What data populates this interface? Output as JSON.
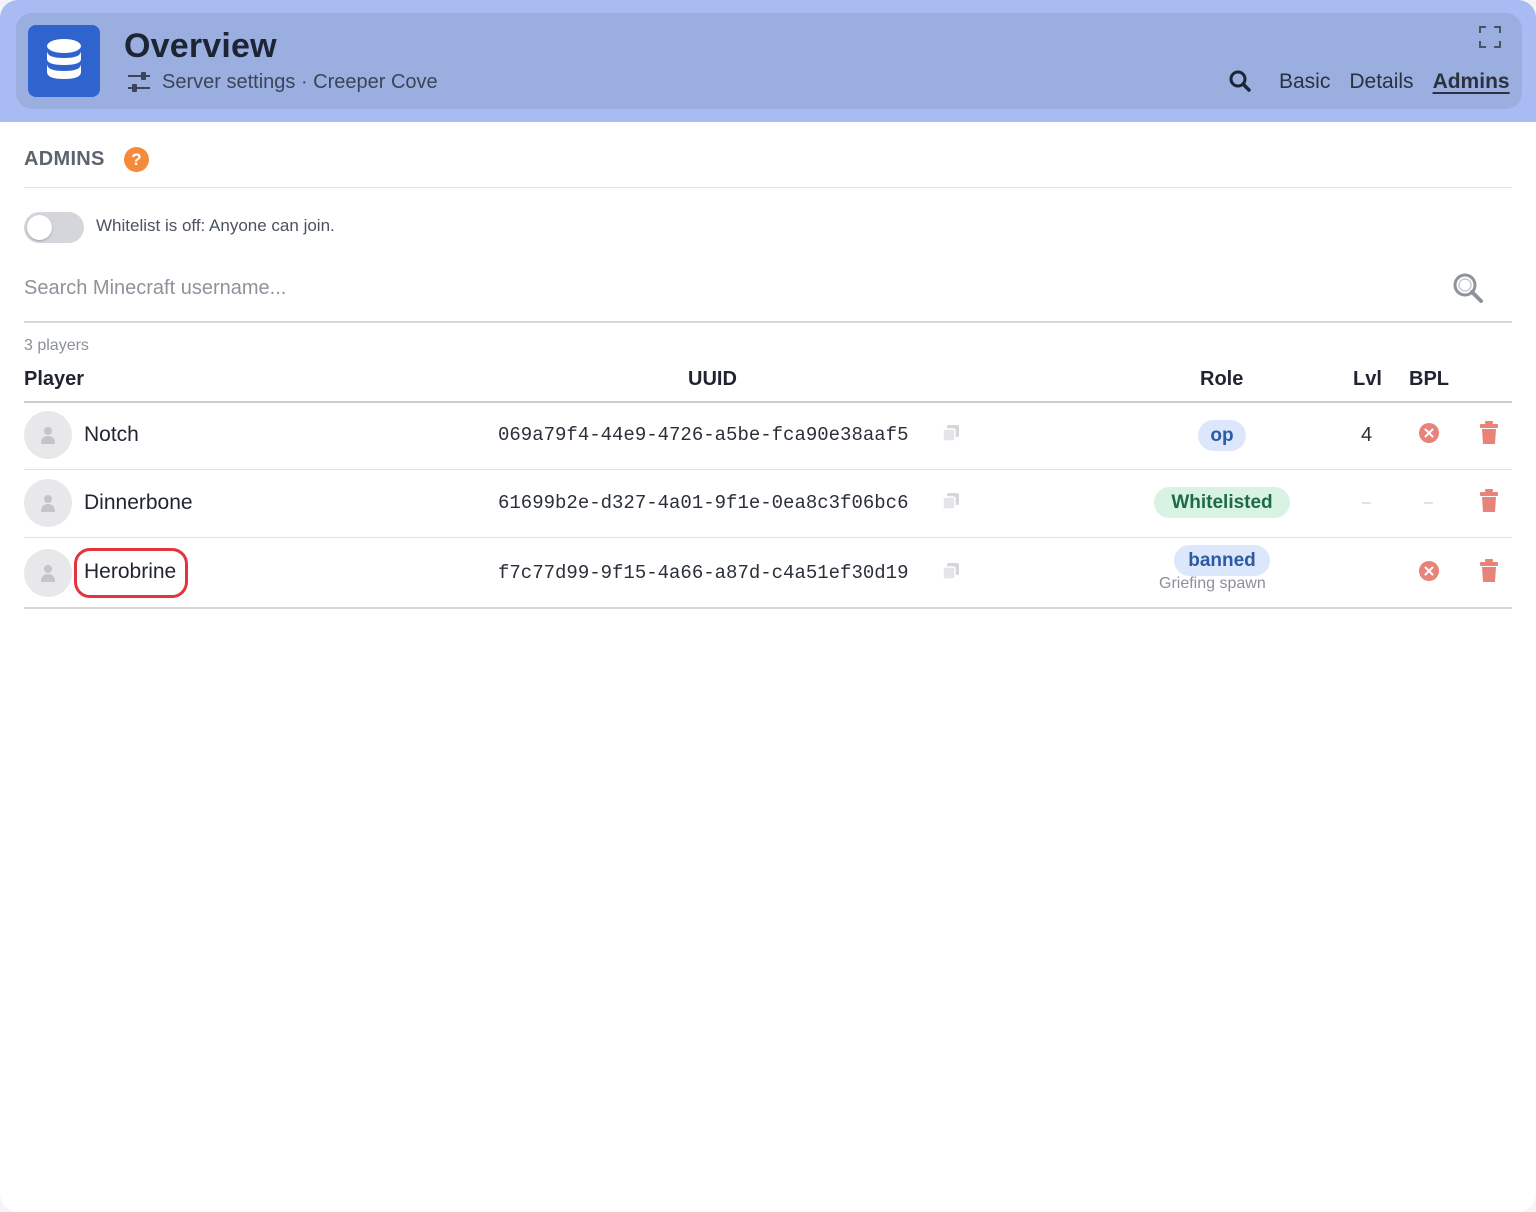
{
  "header": {
    "title": "Overview",
    "subtitle": "Server settings · Creeper Cove",
    "tabs": [
      {
        "label": "Basic",
        "active": false
      },
      {
        "label": "Details",
        "active": false
      },
      {
        "label": "Admins",
        "active": true
      }
    ]
  },
  "section": {
    "title": "ADMINS",
    "help_symbol": "?"
  },
  "whitelist": {
    "enabled": false,
    "label": "Whitelist is off: Anyone can join."
  },
  "search": {
    "placeholder": "Search Minecraft username..."
  },
  "table": {
    "count_label": "3 players",
    "columns": [
      "Player",
      "UUID",
      "Role",
      "Lvl",
      "BPL"
    ],
    "rows": [
      {
        "name": "Notch",
        "uuid": "069a79f4-44e9-4726-a5be-fca90e38aaf5",
        "role": "op",
        "reason": "",
        "lvl": "4",
        "bpl": "x"
      },
      {
        "name": "Dinnerbone",
        "uuid": "61699b2e-d327-4a01-9f1e-0ea8c3f06bc6",
        "role": "Whitelisted",
        "reason": "",
        "lvl": "–",
        "bpl": "–"
      },
      {
        "name": "Herobrine",
        "uuid": "f7c77d99-9f15-4a66-a87d-c4a51ef30d19",
        "role": "banned",
        "reason": "Griefing spawn",
        "lvl": "",
        "bpl": "x"
      }
    ]
  },
  "colors": {
    "header_band": "#a8bcf3",
    "header_card": "#9aafe0",
    "logo_bg": "#2f64cf",
    "help": "#f58a3a",
    "remove": "#e8837a",
    "highlight": "#e3343f"
  },
  "icons": [
    "database-icon",
    "sliders-icon",
    "expand-icon",
    "search-icon",
    "help-icon",
    "user-icon",
    "copy-icon",
    "x-circle-icon",
    "trash-icon"
  ]
}
